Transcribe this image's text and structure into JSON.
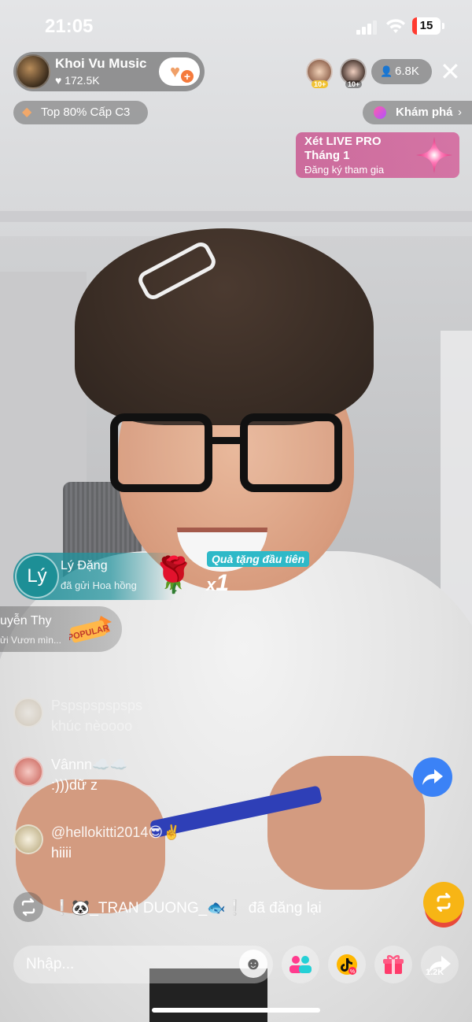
{
  "status_bar": {
    "time": "21:05",
    "battery": "15"
  },
  "host": {
    "name": "Khoi Vu Music",
    "likes": "172.5K"
  },
  "viewer_badges": [
    "10+",
    "10+"
  ],
  "viewer_count": "6.8K",
  "rank": {
    "text": "Top 80% Cấp C3"
  },
  "explore": {
    "label": "Khám phá",
    "chevron": "›"
  },
  "promo": {
    "line1": "Xét LIVE PRO",
    "line2": "Tháng 1",
    "line3": "Đăng ký tham gia"
  },
  "gift1": {
    "avatar_letter": "Lý",
    "name": "Lý Đặng",
    "action": "đã gửi Hoa hồng",
    "badge": "Quà tặng đầu tiên",
    "combo_x": "x",
    "combo_n": "1"
  },
  "gift2": {
    "name": "uyễn Thy",
    "action": "ửi Vươn mìn...",
    "sticker": "POPULAR"
  },
  "comments": [
    {
      "user": "Pspspspspsps",
      "text": "khúc nèoooo"
    },
    {
      "user": "Vânnn☁️☁️",
      "text": ":)))dữ z"
    },
    {
      "user": "@hellokitti2014😎✌️",
      "text": "hiiii"
    }
  ],
  "repost": {
    "text": "❕🐼_TRAN DUONG_🐟❕ đã đăng lại"
  },
  "input": {
    "placeholder": "Nhập..."
  },
  "share": {
    "count": "1.2K"
  },
  "colors": {
    "accent_teal": "#2eb9c8",
    "promo_pink": "#c8508c",
    "share_blue": "#3b82f6",
    "repost_yellow": "#f7b515"
  },
  "icons": [
    "signal-icon",
    "wifi-icon",
    "battery-icon",
    "heart-icon",
    "follow-plus-icon",
    "person-icon",
    "close-icon",
    "gem-icon",
    "planet-icon",
    "chevron-right-icon",
    "sparkle-icon",
    "rose-gift-icon",
    "popular-sticker-icon",
    "share-arrow-icon",
    "repost-icon",
    "emoji-icon",
    "multi-guest-icon",
    "tiktok-shop-icon",
    "gift-icon",
    "share-icon"
  ]
}
